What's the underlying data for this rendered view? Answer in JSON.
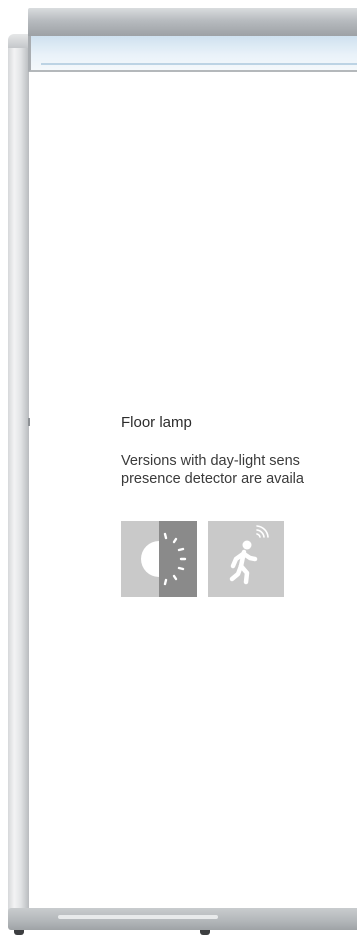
{
  "product": {
    "title": "Floor lamp",
    "description_lines": [
      "Versions with day-light sens",
      "presence detector are availa"
    ]
  },
  "icons": {
    "daylight": "daylight-sensor-icon",
    "presence": "presence-detector-icon"
  },
  "colors": {
    "icon_background": "#c9c9c9",
    "icon_dark": "#8a8a8a",
    "icon_foreground": "#ffffff",
    "text": "#3a3a3a"
  }
}
